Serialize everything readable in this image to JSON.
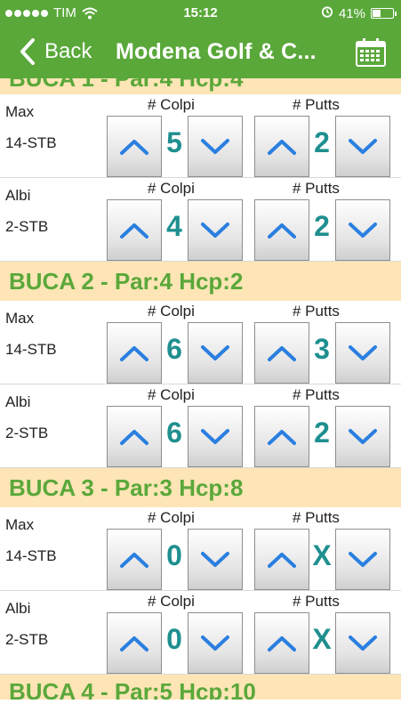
{
  "status": {
    "carrier": "TIM",
    "time": "15:12",
    "battery": "41%"
  },
  "nav": {
    "back_label": "Back",
    "title": "Modena Golf & C..."
  },
  "holes": [
    {
      "title": "BUCA 1 - Par:4 Hcp:4",
      "players": [
        {
          "name": "Max",
          "hcp": "14-STB",
          "colpi_label": "# Colpi",
          "putts_label": "# Putts",
          "colpi": "5",
          "putts": "2"
        },
        {
          "name": "Albi",
          "hcp": "2-STB",
          "colpi_label": "# Colpi",
          "putts_label": "# Putts",
          "colpi": "4",
          "putts": "2"
        }
      ]
    },
    {
      "title": "BUCA 2 - Par:4 Hcp:2",
      "players": [
        {
          "name": "Max",
          "hcp": "14-STB",
          "colpi_label": "# Colpi",
          "putts_label": "# Putts",
          "colpi": "6",
          "putts": "3"
        },
        {
          "name": "Albi",
          "hcp": "2-STB",
          "colpi_label": "# Colpi",
          "putts_label": "# Putts",
          "colpi": "6",
          "putts": "2"
        }
      ]
    },
    {
      "title": "BUCA 3 - Par:3 Hcp:8",
      "players": [
        {
          "name": "Max",
          "hcp": "14-STB",
          "colpi_label": "# Colpi",
          "putts_label": "# Putts",
          "colpi": "0",
          "putts": "X"
        },
        {
          "name": "Albi",
          "hcp": "2-STB",
          "colpi_label": "# Colpi",
          "putts_label": "# Putts",
          "colpi": "0",
          "putts": "X"
        }
      ]
    },
    {
      "title": "BUCA 4 - Par:5 Hcp:10",
      "players": []
    }
  ],
  "colors": {
    "green": "#5aa83a",
    "header_bg": "#fde5b6",
    "value": "#1f8f8f",
    "arrow": "#2a7fe0"
  }
}
